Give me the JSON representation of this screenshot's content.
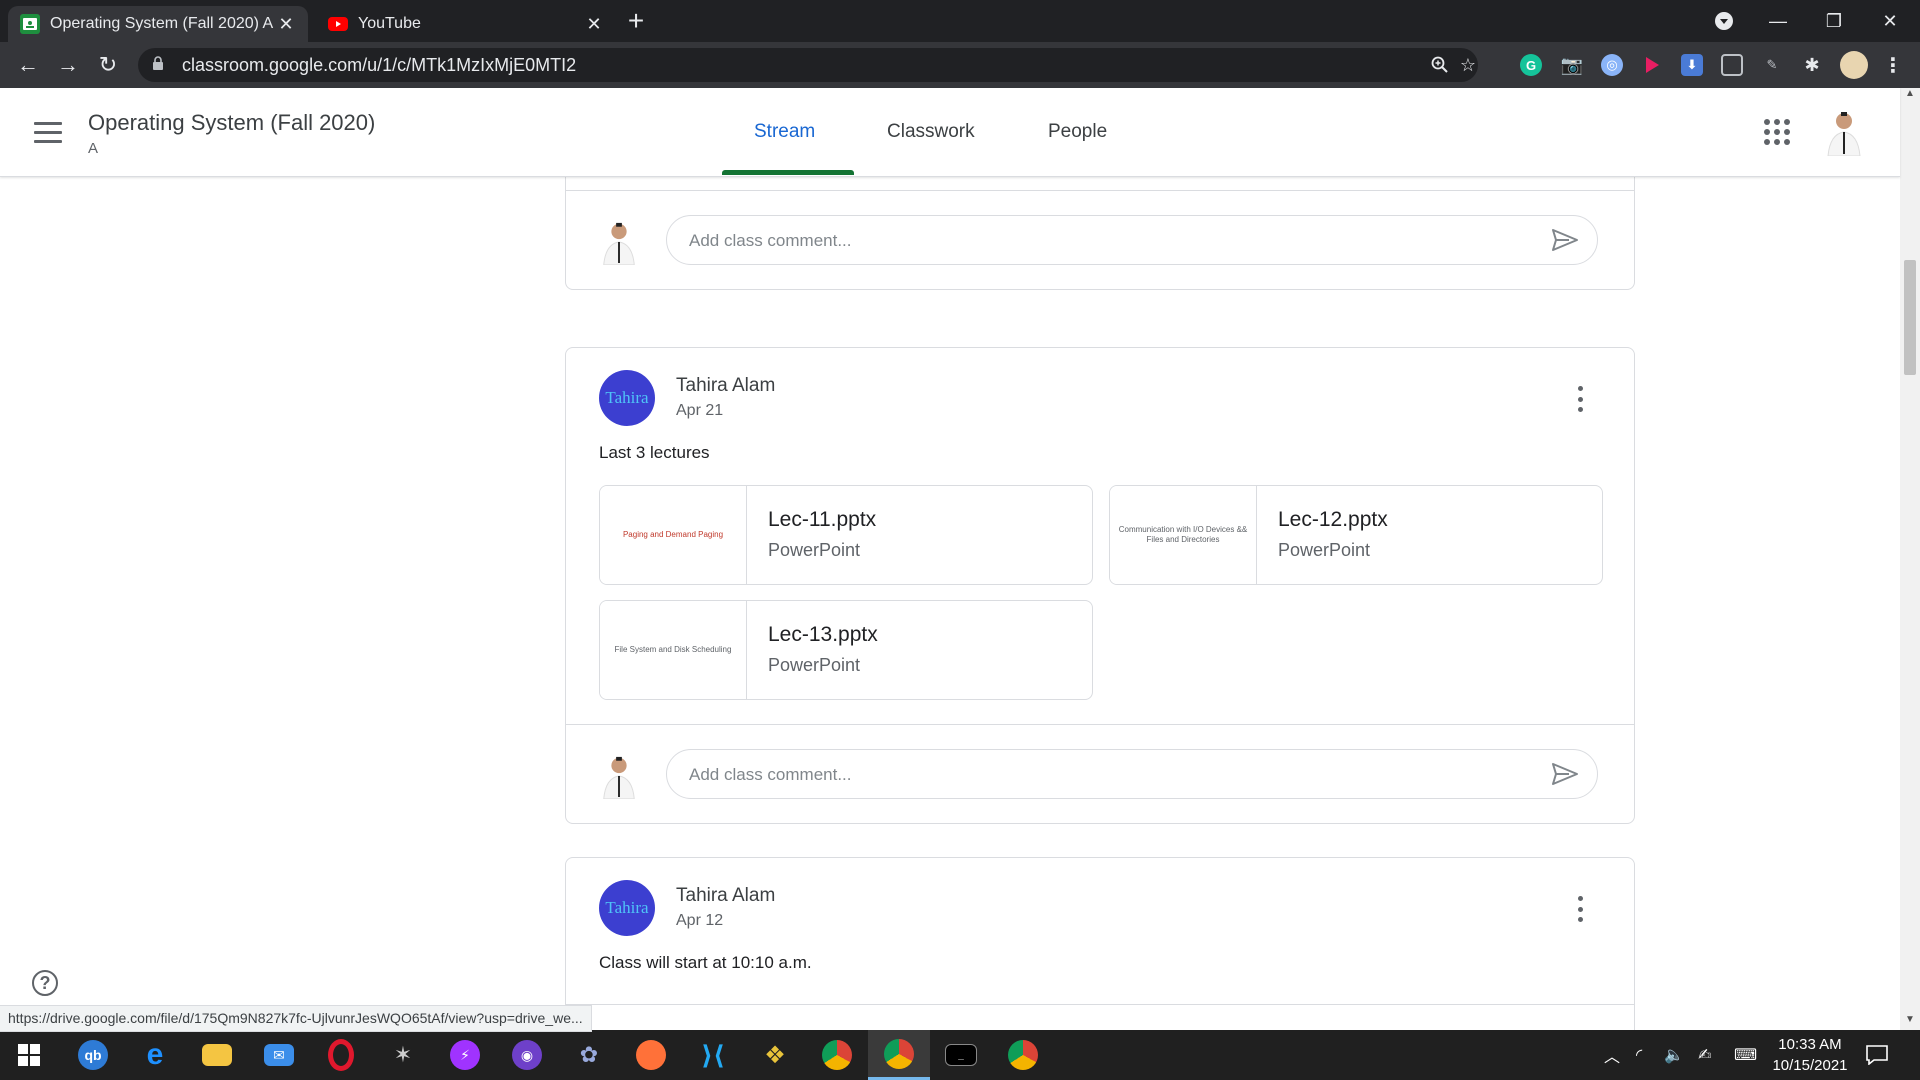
{
  "browser": {
    "tabs": [
      {
        "title": "Operating System (Fall 2020) A",
        "active": true
      },
      {
        "title": "YouTube",
        "active": false
      }
    ],
    "url": "classroom.google.com/u/1/c/MTk1MzIxMjE0MTI2",
    "status_url": "https://drive.google.com/file/d/175Qm9N827k7fc-UjlvunrJesWQO65tAf/view?usp=drive_we..."
  },
  "classroom": {
    "class_title": "Operating System (Fall 2020)",
    "section": "A",
    "tabs": [
      "Stream",
      "Classwork",
      "People"
    ],
    "active_tab": "Stream"
  },
  "comment_placeholder": "Add class comment...",
  "posts": [
    {
      "author": "Tahira Alam",
      "avatar_text": "Tahira",
      "date": "Apr 21",
      "text": "Last 3 lectures",
      "attachments": [
        {
          "name": "Lec-11.pptx",
          "type": "PowerPoint",
          "thumb": "Paging and Demand Paging"
        },
        {
          "name": "Lec-12.pptx",
          "type": "PowerPoint",
          "thumb": "Communication with I/O Devices && Files and Directories"
        },
        {
          "name": "Lec-13.pptx",
          "type": "PowerPoint",
          "thumb": "File System and Disk Scheduling"
        }
      ]
    },
    {
      "author": "Tahira Alam",
      "avatar_text": "Tahira",
      "date": "Apr 12",
      "text": "Class will start at 10:10 a.m."
    }
  ],
  "taskbar": {
    "time": "10:33 AM",
    "date": "10/15/2021"
  },
  "colors": {
    "accent_blue": "#1967d2",
    "tab_underline": "#137333",
    "avatar_bg": "#3c3fd0",
    "chrome_dark": "#202124"
  }
}
